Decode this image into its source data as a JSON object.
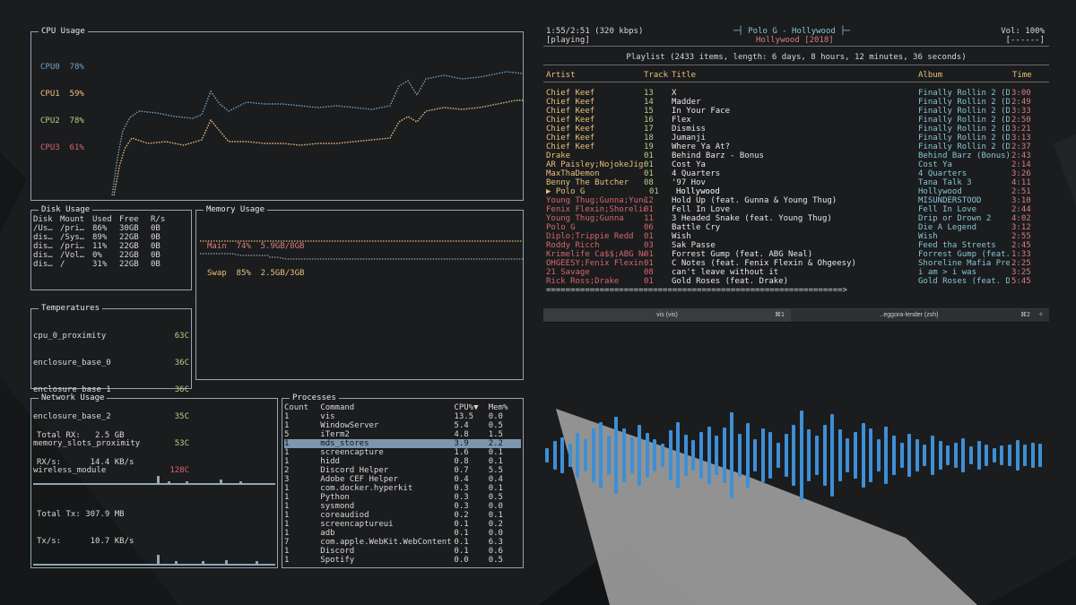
{
  "colors": {
    "panel_border": "#8fa6b5",
    "cpu0": "#6fa3c6",
    "cpu1": "#e8c07a",
    "cpu2": "#b9cf8a",
    "cpu3": "#d4686e",
    "vis_bars": "#3d8fd6",
    "selection": "#7c96ae"
  },
  "cpu": {
    "title": "CPU Usage",
    "rows": [
      {
        "name": "CPU0",
        "pct": "78%"
      },
      {
        "name": "CPU1",
        "pct": "59%"
      },
      {
        "name": "CPU2",
        "pct": "78%"
      },
      {
        "name": "CPU3",
        "pct": "61%"
      }
    ]
  },
  "disk": {
    "title": "Disk Usage",
    "headers": [
      "Disk",
      "Mount",
      "Used",
      "Free",
      "R/s"
    ],
    "rows": [
      [
        "/Us…",
        "/pri…",
        "86%",
        "30GB",
        "0B"
      ],
      [
        "dis…",
        "/Sys…",
        "89%",
        "22GB",
        "0B"
      ],
      [
        "dis…",
        "/pri…",
        "11%",
        "22GB",
        "0B"
      ],
      [
        "dis…",
        "/Vol…",
        "0%",
        "22GB",
        "0B"
      ],
      [
        "dis…",
        "/",
        "31%",
        "22GB",
        "0B"
      ]
    ]
  },
  "memory": {
    "title": "Memory Usage",
    "main_label": "Main",
    "main_pct": "74%",
    "main_val": "5.9GB/8GB",
    "swap_label": "Swap",
    "swap_pct": "85%",
    "swap_val": "2.5GB/3GB"
  },
  "temps": {
    "title": "Temperatures",
    "rows": [
      {
        "name": "cpu_0_proximity",
        "val": "63C",
        "hot": false
      },
      {
        "name": "enclosure_base_0",
        "val": "36C",
        "hot": false
      },
      {
        "name": "enclosure_base_1",
        "val": "36C",
        "hot": false
      },
      {
        "name": "enclosure_base_2",
        "val": "35C",
        "hot": false
      },
      {
        "name": "memory_slots_proximity",
        "val": "53C",
        "hot": false
      },
      {
        "name": "wireless_module",
        "val": "128C",
        "hot": true
      }
    ]
  },
  "network": {
    "title": "Network Usage",
    "total_rx_label": "Total RX:",
    "total_rx": "2.5 GB",
    "rx_rate_label": "RX/s:",
    "rx_rate": "14.4 KB/s",
    "total_tx_label": "Total Tx:",
    "total_tx": "307.9 MB",
    "tx_rate_label": "Tx/s:",
    "tx_rate": "10.7 KB/s"
  },
  "processes": {
    "title": "Processes",
    "headers": [
      "Count",
      "Command",
      "CPU%▼",
      "Mem%"
    ],
    "selected_index": 3,
    "rows": [
      [
        "1",
        "vis",
        "13.5",
        "0.0"
      ],
      [
        "1",
        "WindowServer",
        "5.4",
        "0.5"
      ],
      [
        "5",
        "iTerm2",
        "4.8",
        "1.5"
      ],
      [
        "1",
        "mds_stores",
        "3.9",
        "2.2"
      ],
      [
        "1",
        "screencapture",
        "1.6",
        "0.1"
      ],
      [
        "1",
        "hidd",
        "0.8",
        "0.1"
      ],
      [
        "2",
        "Discord Helper",
        "0.7",
        "5.5"
      ],
      [
        "3",
        "Adobe CEF Helper",
        "0.4",
        "0.4"
      ],
      [
        "1",
        "com.docker.hyperkit",
        "0.3",
        "0.1"
      ],
      [
        "1",
        "Python",
        "0.3",
        "0.5"
      ],
      [
        "1",
        "sysmond",
        "0.3",
        "0.0"
      ],
      [
        "1",
        "coreaudiod",
        "0.2",
        "0.1"
      ],
      [
        "1",
        "screencaptureui",
        "0.1",
        "0.2"
      ],
      [
        "1",
        "adb",
        "0.1",
        "0.0"
      ],
      [
        "7",
        "com.apple.WebKit.WebContent",
        "0.1",
        "6.3"
      ],
      [
        "1",
        "Discord",
        "0.1",
        "0.6"
      ],
      [
        "1",
        "Spotify",
        "0.0",
        "0.5"
      ]
    ]
  },
  "player": {
    "time": "1:55/2:51 (320 kbps)",
    "state": "[playing]",
    "now_artist_title": "Polo G - Hollywood",
    "now_album": "Hollywood",
    "now_year": "[2018]",
    "volume": "Vol: 100%",
    "volume_bar": "[------]",
    "playlist_info": "Playlist (2433 items, length: 6 days, 8 hours, 12 minutes, 36 seconds)",
    "headers": {
      "artist": "Artist",
      "track": "Track",
      "title": "Title",
      "album": "Album",
      "time": "Time"
    },
    "rows": [
      {
        "artist": "Chief Keef",
        "track": "13",
        "title": "X",
        "album": "Finally Rollin 2 (De",
        "time": "3:00",
        "cls": "y"
      },
      {
        "artist": "Chief Keef",
        "track": "14",
        "title": "Madder",
        "album": "Finally Rollin 2 (De",
        "time": "2:49",
        "cls": "y"
      },
      {
        "artist": "Chief Keef",
        "track": "15",
        "title": "In Your Face",
        "album": "Finally Rollin 2 (De",
        "time": "3:33",
        "cls": "y"
      },
      {
        "artist": "Chief Keef",
        "track": "16",
        "title": "Flex",
        "album": "Finally Rollin 2 (De",
        "time": "2:50",
        "cls": "y"
      },
      {
        "artist": "Chief Keef",
        "track": "17",
        "title": "Dismiss",
        "album": "Finally Rollin 2 (De",
        "time": "3:21",
        "cls": "y"
      },
      {
        "artist": "Chief Keef",
        "track": "18",
        "title": "Jumanji",
        "album": "Finally Rollin 2 (De",
        "time": "3:13",
        "cls": "y"
      },
      {
        "artist": "Chief Keef",
        "track": "19",
        "title": "Where Ya At?",
        "album": "Finally Rollin 2 (De",
        "time": "2:37",
        "cls": "y"
      },
      {
        "artist": "Drake",
        "track": "01",
        "title": "Behind Barz - Bonus",
        "album": "Behind Barz (Bonus)",
        "time": "2:43",
        "cls": "y"
      },
      {
        "artist": "AR Paisley;NojokeJigs",
        "track": "01",
        "title": "Cost Ya",
        "album": "Cost Ya",
        "time": "2:14",
        "cls": "y"
      },
      {
        "artist": "MaxThaDemon",
        "track": "01",
        "title": "4 Quarters",
        "album": "4 Quarters",
        "time": "3:26",
        "cls": "y"
      },
      {
        "artist": "Benny The Butcher",
        "track": "08",
        "title": "'97 Hov",
        "album": "Tana Talk 3",
        "time": "4:11",
        "cls": "y"
      },
      {
        "artist": "▶ Polo G",
        "track": "01",
        "title": "Hollywood",
        "album": "Hollywood",
        "time": "2:51",
        "cls": "now"
      },
      {
        "artist": "Young Thug;Gunna;Yung",
        "track": "12",
        "title": "Hold Up (feat. Gunna & Young Thug)",
        "album": "MISUNDERSTOOD",
        "time": "3:10",
        "cls": "p"
      },
      {
        "artist": "Fenix Flexin;Shorelin",
        "track": "01",
        "title": "Fell In Love",
        "album": "Fell In Love",
        "time": "2:44",
        "cls": "p"
      },
      {
        "artist": "Young Thug;Gunna",
        "track": "11",
        "title": "3 Headed Snake (feat. Young Thug)",
        "album": "Drip or Drown 2",
        "time": "4:02",
        "cls": "p"
      },
      {
        "artist": "Polo G",
        "track": "06",
        "title": "Battle Cry",
        "album": "Die A Legend",
        "time": "3:12",
        "cls": "p"
      },
      {
        "artist": "Diplo;Trippie Redd",
        "track": "01",
        "title": "Wish",
        "album": "Wish",
        "time": "2:55",
        "cls": "p"
      },
      {
        "artist": "Roddy Ricch",
        "track": "03",
        "title": "Sak Passe",
        "album": "Feed tha Streets",
        "time": "2:45",
        "cls": "p"
      },
      {
        "artist": "Krimelife Ca$$;ABG Ne",
        "track": "01",
        "title": "Forrest Gump (feat. ABG Neal)",
        "album": "Forrest Gump (feat.",
        "time": "1:33",
        "cls": "p"
      },
      {
        "artist": "OHGEESY;Fenix Flexin;",
        "track": "01",
        "title": "C Notes (feat. Fenix Flexin & Ohgeesy)",
        "album": "Shoreline Mafia Pres",
        "time": "2:25",
        "cls": "p"
      },
      {
        "artist": "21 Savage",
        "track": "08",
        "title": "can't leave without it",
        "album": "i am > i was",
        "time": "3:25",
        "cls": "p"
      },
      {
        "artist": "Rick Ross;Drake",
        "track": "01",
        "title": "Gold Roses (feat. Drake)",
        "album": "Gold Roses (feat. Dr",
        "time": "5:45",
        "cls": "p"
      }
    ],
    "progress": "=============================================================>"
  },
  "tabs": [
    {
      "label": "vis (vis)",
      "shortcut": "⌘1"
    },
    {
      "label": "..eggora-lender (zsh)",
      "shortcut": "⌘2"
    }
  ],
  "vis": {
    "levels": [
      0.14,
      0.26,
      0.34,
      0.22,
      0.42,
      0.3,
      0.5,
      0.62,
      0.36,
      0.72,
      0.5,
      0.34,
      0.56,
      0.42,
      0.3,
      0.22,
      0.46,
      0.62,
      0.38,
      0.28,
      0.44,
      0.54,
      0.36,
      0.52,
      0.8,
      0.4,
      0.6,
      0.3,
      0.5,
      0.44,
      0.24,
      0.4,
      0.56,
      0.84,
      0.48,
      0.36,
      0.56,
      0.76,
      0.48,
      0.32,
      0.44,
      0.6,
      0.5,
      0.3,
      0.54,
      0.36,
      0.24,
      0.4,
      0.3,
      0.2,
      0.36,
      0.26,
      0.18,
      0.24,
      0.32,
      0.16,
      0.26,
      0.2,
      0.14,
      0.18,
      0.2,
      0.28,
      0.2,
      0.24,
      0.22
    ]
  }
}
